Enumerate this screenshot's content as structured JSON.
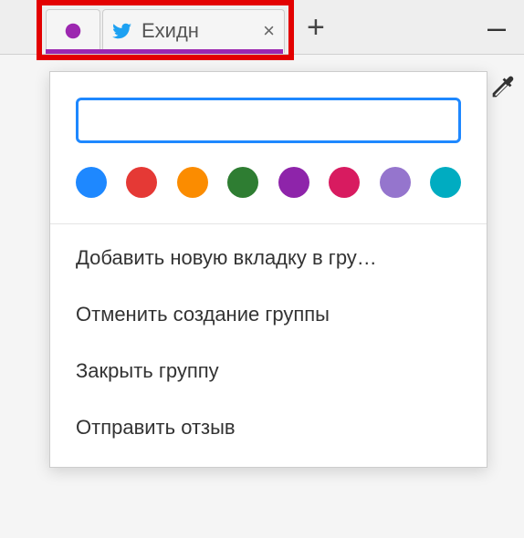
{
  "tabs": {
    "group_color": "#9c27b0",
    "tab1": {
      "title": ""
    },
    "tab2": {
      "title": "Ехидн",
      "close_glyph": "×"
    },
    "new_tab_glyph": "+",
    "minimize_glyph": "–"
  },
  "popup": {
    "name_input_value": "",
    "name_input_placeholder": "",
    "swatches": [
      "#1e88ff",
      "#e53935",
      "#fb8c00",
      "#2e7d32",
      "#8e24aa",
      "#d81b60",
      "#9575cd",
      "#00acc1"
    ],
    "menu": {
      "add_tab": "Добавить новую вкладку в гру…",
      "cancel_create": "Отменить создание группы",
      "close_group": "Закрыть группу",
      "send_feedback": "Отправить отзыв"
    }
  },
  "icons": {
    "twitter": "twitter-bird-icon",
    "eyedropper": "eyedropper-icon"
  }
}
